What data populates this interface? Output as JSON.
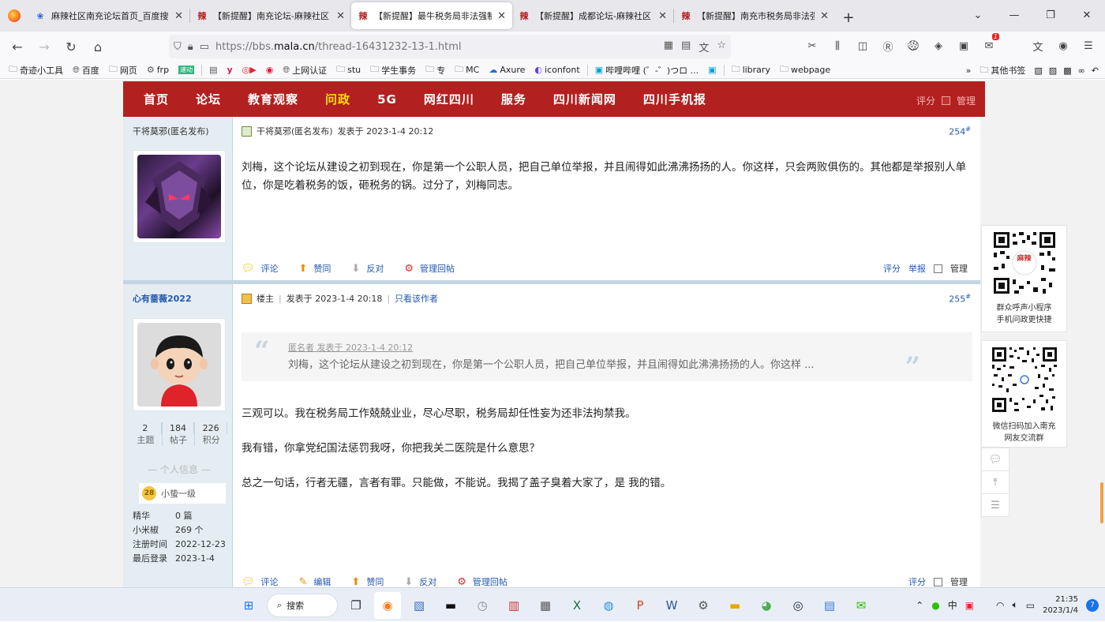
{
  "browser": {
    "tabs": [
      {
        "label": "麻辣社区南充论坛首页_百度搜索",
        "icon": "baidu-icon",
        "active": false
      },
      {
        "label": "【新提醒】南充论坛-麻辣社区",
        "icon": "mala-icon",
        "active": false
      },
      {
        "label": "【新提醒】最牛税务局非法强制",
        "icon": "mala-icon",
        "active": true
      },
      {
        "label": "【新提醒】成都论坛-麻辣社区",
        "icon": "mala-icon",
        "active": false
      },
      {
        "label": "【新提醒】南充市税务局非法强",
        "icon": "mala-icon",
        "active": false
      }
    ],
    "url_prefix": "https://bbs.",
    "url_domain": "mala.cn",
    "url_path": "/thread-16431232-13-1.html",
    "bookmarks": [
      "奇迹小工具",
      "百度",
      "网页",
      "frp",
      "速动",
      "",
      "",
      "",
      "",
      "上网认证",
      "stu",
      "学生事务",
      "专",
      "MC",
      "Axure",
      "iconfont",
      "哔哩哔哩 (゜-゜)つロ ...",
      "",
      "library",
      "webpage"
    ],
    "other_bookmarks": "其他书签",
    "toolbar_badge": "1"
  },
  "site_nav": {
    "items": [
      "首页",
      "论坛",
      "教育观察",
      "问政",
      "5G",
      "网红四川",
      "服务",
      "四川新闻网",
      "四川手机报"
    ],
    "highlight_index": 3,
    "ghost_rate": "评分",
    "ghost_manage": "管理"
  },
  "post1": {
    "author": "干将莫邪(匿名发布)",
    "header_author": "干将莫邪(匿名发布)",
    "posted": "发表于 2023-1-4 20:12",
    "floor": "254",
    "floor_mark": "#",
    "content": "刘梅，这个论坛从建设之初到现在，你是第一个公职人员，把自己单位举报，并且闹得如此沸沸扬扬的人。你这样，只会两败俱伤的。其他都是举报别人单位，你是吃着税务的饭，砸税务的锅。过分了，刘梅同志。",
    "actions": {
      "comment": "评论",
      "support": "赞同",
      "oppose": "反对",
      "manage_reply": "管理回帖"
    },
    "right_actions": {
      "rate": "评分",
      "report": "举报",
      "manage": "管理"
    }
  },
  "post2": {
    "author": "心有蔷薇2022",
    "role": "楼主",
    "posted": "发表于 2023-1-4 20:18",
    "only_author": "只看该作者",
    "floor": "255",
    "floor_mark": "#",
    "quote_author": "匿名者 发表于 2023-1-4 20:12",
    "quote_text": "刘梅，这个论坛从建设之初到现在，你是第一个公职人员，把自己单位举报，并且闹得如此沸沸扬扬的人。你这样 ...",
    "paragraphs": [
      "三观可以。我在税务局工作兢兢业业，尽心尽职，税务局却任性妄为还非法拘禁我。",
      "我有错，你拿党纪国法惩罚我呀，你把我关二医院是什么意思？",
      "总之一句话，行者无疆，言者有罪。只能做，不能说。我揭了盖子臭着大家了，是 我的错。"
    ],
    "stats": [
      {
        "value": "2",
        "label": "主题"
      },
      {
        "value": "184",
        "label": "帖子"
      },
      {
        "value": "226",
        "label": "积分"
      }
    ],
    "personal_info": "个人信息",
    "level_badge": "28",
    "level_name": "小蛰一级",
    "meta": [
      {
        "key": "精华",
        "value": "0 篇"
      },
      {
        "key": "小米椒",
        "value": "269 个"
      },
      {
        "key": "注册时间",
        "value": "2022-12-23"
      },
      {
        "key": "最后登录",
        "value": "2023-1-4"
      }
    ],
    "actions": {
      "comment": "评论",
      "edit": "编辑",
      "support": "赞同",
      "oppose": "反对",
      "manage_reply": "管理回帖"
    },
    "right_actions": {
      "rate": "评分",
      "manage": "管理"
    }
  },
  "widgets": {
    "miniapp_caption_1": "群众呼声小程序",
    "miniapp_caption_2": "手机问政更快捷",
    "miniapp_logo": "麻辣",
    "wechat_caption_1": "微信扫码加入南充",
    "wechat_caption_2": "网友交流群"
  },
  "taskbar": {
    "search_label": "搜索",
    "ime": "中",
    "time": "21:35",
    "date": "2023/1/4",
    "notifications": "7"
  }
}
